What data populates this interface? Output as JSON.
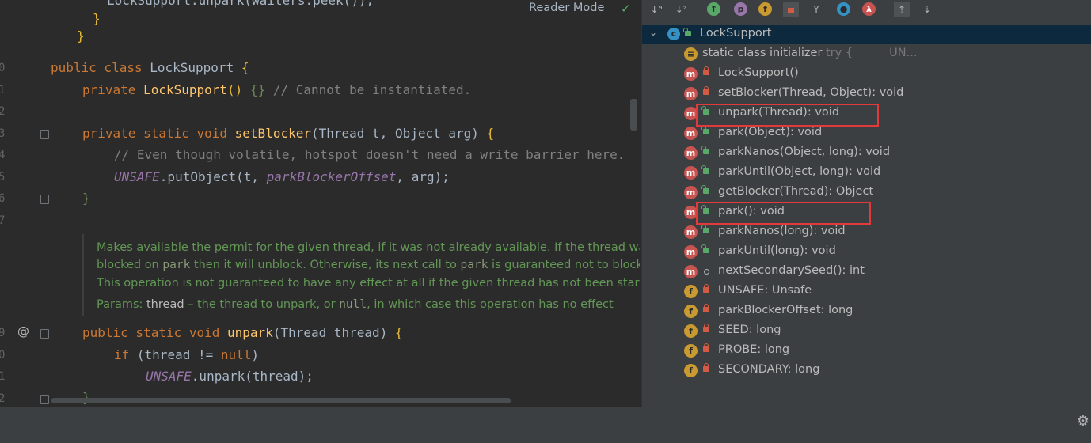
{
  "editor": {
    "reader_mode": "Reader Mode",
    "line_numbers": [
      "0",
      "1",
      "2",
      "3",
      "4",
      "5",
      "6",
      "7",
      "9",
      "0",
      "1",
      "2"
    ],
    "lines": {
      "l0": "LockSupport.unpark(waiters.peek());",
      "l1": "}",
      "l2": "}",
      "class_kw": "public class ",
      "class_name": "LockSupport ",
      "brace_open": "{",
      "ctor_kw": "private ",
      "ctor_name": "LockSupport",
      "ctor_paren": "() ",
      "ctor_body": "{}",
      "ctor_comment": " // Cannot be instantiated.",
      "setblk_kw": "private static void ",
      "setblk_name": "setBlocker",
      "setblk_params": "(Thread t, Object arg) ",
      "setblk_brace": "{",
      "comment_line": "// Even though volatile, hotspot doesn't need a write barrier here.",
      "unsafe": "UNSAFE",
      "put_call": ".putObject(t, ",
      "park_off": "parkBlockerOffset",
      "put_end": ", arg);",
      "close1": "}",
      "unpark_kw": "public static void ",
      "unpark_name": "unpark",
      "unpark_params": "(Thread thread) ",
      "unpark_brace": "{",
      "if_kw": "if ",
      "if_cond": "(thread != ",
      "null_kw": "null",
      "if_end": ")",
      "unsafe2": "UNSAFE",
      "unpark_call": ".unpark(thread);",
      "close2": "}"
    },
    "doc": {
      "line1": "Makes available the permit for the given thread, if it was not already available. If the thread was",
      "line2a": "blocked on ",
      "line2b": "park",
      "line2c": " then it will unblock. Otherwise, its next call to ",
      "line2d": "park",
      "line2e": " is guaranteed not to block.",
      "line3": "This operation is not guaranteed to have any effect at all if the given thread has not been started.",
      "params_label": "Params: ",
      "param_name": "thread",
      "param_desc1": " – the thread to unpark, or ",
      "param_null": "null",
      "param_desc2": ", in which case this operation has no effect"
    }
  },
  "structure": {
    "root": "LockSupport",
    "members": [
      {
        "icon": "s",
        "access": "none",
        "label": "static class initializer",
        "extra": " try {          UN..."
      },
      {
        "icon": "m",
        "access": "private",
        "label": "LockSupport()",
        "extra": ""
      },
      {
        "icon": "m",
        "access": "private",
        "label": "setBlocker(Thread, Object): void",
        "extra": ""
      },
      {
        "icon": "m",
        "access": "public",
        "label": "unpark(Thread): void",
        "extra": ""
      },
      {
        "icon": "m",
        "access": "public",
        "label": "park(Object): void",
        "extra": ""
      },
      {
        "icon": "m",
        "access": "public",
        "label": "parkNanos(Object, long): void",
        "extra": ""
      },
      {
        "icon": "m",
        "access": "public",
        "label": "parkUntil(Object, long): void",
        "extra": ""
      },
      {
        "icon": "m",
        "access": "public",
        "label": "getBlocker(Thread): Object",
        "extra": ""
      },
      {
        "icon": "m",
        "access": "public",
        "label": "park(): void",
        "extra": ""
      },
      {
        "icon": "m",
        "access": "public",
        "label": "parkNanos(long): void",
        "extra": ""
      },
      {
        "icon": "m",
        "access": "public",
        "label": "parkUntil(long): void",
        "extra": ""
      },
      {
        "icon": "m",
        "access": "package",
        "label": "nextSecondarySeed(): int",
        "extra": ""
      },
      {
        "icon": "f",
        "access": "private",
        "label": "UNSAFE: Unsafe",
        "extra": ""
      },
      {
        "icon": "f",
        "access": "private",
        "label": "parkBlockerOffset: long",
        "extra": ""
      },
      {
        "icon": "f",
        "access": "private",
        "label": "SEED: long",
        "extra": ""
      },
      {
        "icon": "f",
        "access": "private",
        "label": "PROBE: long",
        "extra": ""
      },
      {
        "icon": "f",
        "access": "private",
        "label": "SECONDARY: long",
        "extra": ""
      }
    ]
  },
  "colors": {
    "highlight": "#e03a3a",
    "selection": "#0d293e"
  }
}
